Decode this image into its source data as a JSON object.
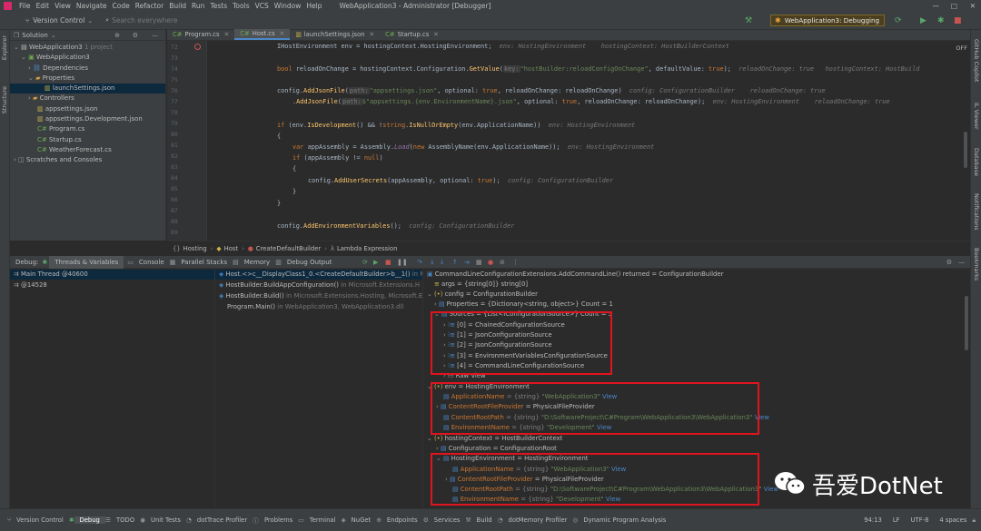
{
  "titlebar": {
    "menus": [
      "File",
      "Edit",
      "View",
      "Navigate",
      "Code",
      "Refactor",
      "Build",
      "Run",
      "Tests",
      "Tools",
      "VCS",
      "Window",
      "Help"
    ],
    "title": "WebApplication3 - Administrator [Debugger]",
    "vcs_label": "Version Control",
    "search_placeholder": "Search everywhere"
  },
  "toolbar": {
    "run_config": "WebApplication3: Debugging"
  },
  "left_strip": [
    "Explorer",
    "Structure"
  ],
  "right_strip": [
    "GitHub Copilot",
    "IL Viewer",
    "Database",
    "Notifications",
    "Bookmarks"
  ],
  "solution": {
    "header": "Solution",
    "items": [
      {
        "label": "WebApplication3",
        "extra": "1 project",
        "indent": 0
      },
      {
        "label": "WebApplication3",
        "extra": "",
        "indent": 1
      },
      {
        "label": "Dependencies",
        "extra": "",
        "indent": 2
      },
      {
        "label": "Properties",
        "extra": "",
        "indent": 2
      },
      {
        "label": "launchSettings.json",
        "extra": "",
        "indent": 3
      },
      {
        "label": "Controllers",
        "extra": "",
        "indent": 2
      },
      {
        "label": "appsettings.json",
        "extra": "",
        "indent": 2
      },
      {
        "label": "appsettings.Development.json",
        "extra": "",
        "indent": 3
      },
      {
        "label": "Program.cs",
        "extra": "",
        "indent": 2
      },
      {
        "label": "Startup.cs",
        "extra": "",
        "indent": 2
      },
      {
        "label": "WeatherForecast.cs",
        "extra": "",
        "indent": 2
      },
      {
        "label": "Scratches and Consoles",
        "extra": "",
        "indent": 0
      }
    ]
  },
  "editor": {
    "tabs": [
      "Program.cs",
      "Host.cs",
      "launchSettings.json",
      "Startup.cs"
    ],
    "active_tab": "Host.cs",
    "line_numbers": [
      "72",
      "73",
      "74",
      "75",
      "76",
      "77",
      "78",
      "79",
      "80",
      "81",
      "82",
      "83",
      "84",
      "85",
      "86",
      "87",
      "88",
      "89"
    ],
    "off_label": "OFF",
    "breadcrumb": [
      "Hosting",
      "Host",
      "CreateDefaultBuilder",
      "Lambda Expression"
    ]
  },
  "debug": {
    "label": "Debug:",
    "tabs": [
      "Threads & Variables",
      "Console",
      "Parallel Stacks",
      "Memory",
      "Debug Output"
    ],
    "threads": [
      {
        "label": "Main Thread @40600"
      },
      {
        "label": "@14528"
      }
    ],
    "frames": [
      {
        "name": "Host.<>c__DisplayClass1_0.<CreateDefaultBuilder>b__1()",
        "loc": "in Mi"
      },
      {
        "name": "HostBuilder.BuildAppConfiguration()",
        "loc": "in Microsoft.Extensions.H"
      },
      {
        "name": "HostBuilder.Build()",
        "loc": "in Microsoft.Extensions.Hosting, Microsoft.Ext"
      },
      {
        "name": "Program.Main()",
        "loc": "in WebApplication3, WebApplication3.dll"
      }
    ],
    "vars": {
      "returned": "CommandLineConfigurationExtensions.AddCommandLine() returned = ConfigurationBuilder",
      "args": "args = {string[0]} string[0]",
      "config": "config = ConfigurationBuilder",
      "properties": "Properties = {Dictionary<string, object>} Count = 1",
      "sources": "Sources = {List<IConfigurationSource>} Count = 5",
      "source_items": [
        "[0] = ChainedConfigurationSource",
        "[1] = JsonConfigurationSource",
        "[2] = JsonConfigurationSource",
        "[3] = EnvironmentVariablesConfigurationSource",
        "[4] = CommandLineConfigurationSource"
      ],
      "raw_view": "Raw View",
      "env": "env = HostingEnvironment",
      "env_items": [
        {
          "name": "ApplicationName",
          "type": "{string}",
          "value": "\"WebApplication3\"",
          "view": "View"
        },
        {
          "name": "ContentRootFileProvider",
          "type": "",
          "value": "= PhysicalFileProvider",
          "view": ""
        },
        {
          "name": "ContentRootPath",
          "type": "{string}",
          "value": "\"D:\\SoftwareProject\\C#Program\\WebApplication3\\WebApplication3\"",
          "view": "View"
        },
        {
          "name": "EnvironmentName",
          "type": "{string}",
          "value": "\"Development\"",
          "view": "View"
        }
      ],
      "hosting_context": "hostingContext = HostBuilderContext",
      "configuration": "Configuration = ConfigurationRoot",
      "hosting_env": "HostingEnvironment = HostingEnvironment",
      "hosting_env_items": [
        {
          "name": "ApplicationName",
          "type": "{string}",
          "value": "\"WebApplication3\"",
          "view": "View"
        },
        {
          "name": "ContentRootFileProvider",
          "type": "",
          "value": "= PhysicalFileProvider",
          "view": ""
        },
        {
          "name": "ContentRootPath",
          "type": "{string}",
          "value": "\"D:\\SoftwareProject\\C#Program\\WebApplication3\\WebApplication3\"",
          "view": "View"
        },
        {
          "name": "EnvironmentName",
          "type": "{string}",
          "value": "\"Development\"",
          "view": "View"
        }
      ]
    }
  },
  "statusbar": {
    "items": [
      "Version Control",
      "Debug",
      "TODO",
      "Unit Tests",
      "dotTrace Profiler",
      "Problems",
      "Terminal",
      "NuGet",
      "Endpoints",
      "Services",
      "Build",
      "dotMemory Profiler",
      "Dynamic Program Analysis"
    ],
    "position": "94:13",
    "line_ending": "LF",
    "encoding": "UTF-8",
    "indent": "4 spaces"
  },
  "watermark": "吾爱DotNet",
  "colors": {
    "red_box": "#e0141e",
    "selection": "#0d293e",
    "accent": "#4a88c7"
  }
}
